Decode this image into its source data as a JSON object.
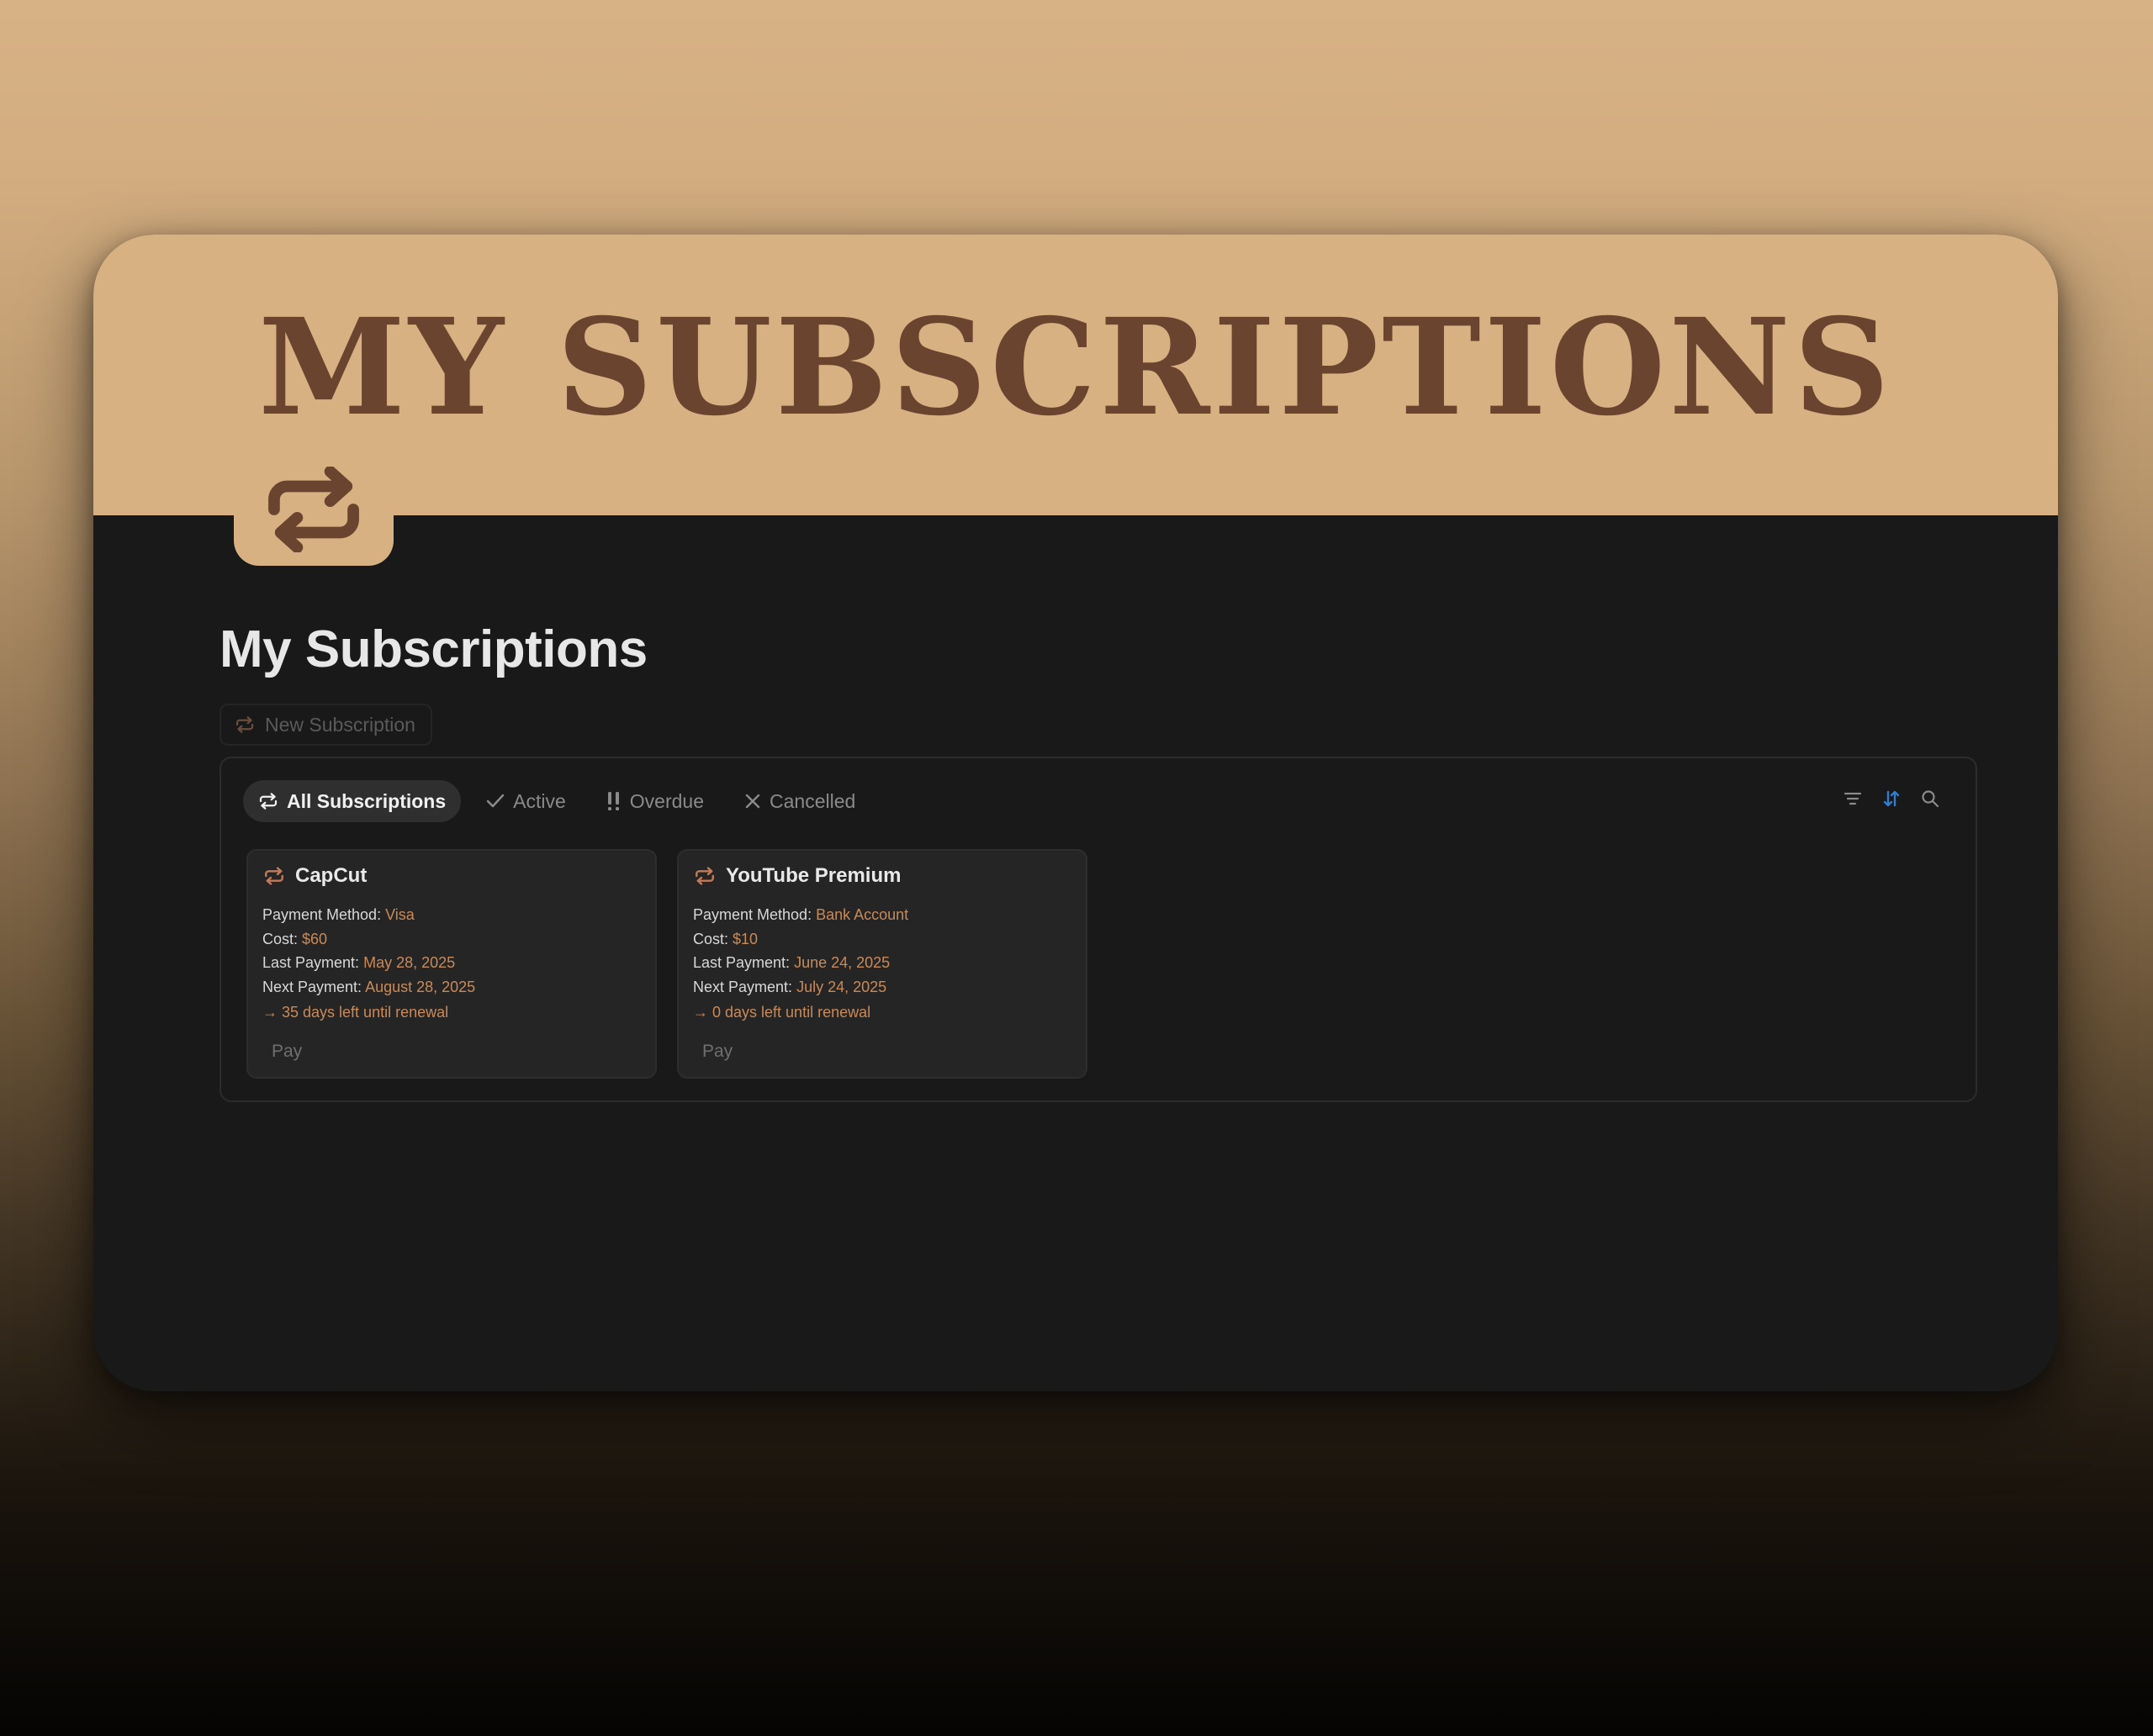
{
  "banner": {
    "title": "MY SUBSCRIPTIONS",
    "icon": "repeat-icon"
  },
  "page": {
    "title": "My Subscriptions",
    "new_button": "New Subscription"
  },
  "tabs": [
    {
      "label": "All Subscriptions",
      "icon": "repeat-icon",
      "selected": true
    },
    {
      "label": "Active",
      "icon": "check-icon",
      "selected": false
    },
    {
      "label": "Overdue",
      "icon": "double-exclamation-icon",
      "selected": false
    },
    {
      "label": "Cancelled",
      "icon": "x-icon",
      "selected": false
    }
  ],
  "toolbar": {
    "icons": [
      "filter-icon",
      "sort-icon",
      "search-icon"
    ]
  },
  "cards": [
    {
      "name": "CapCut",
      "payment_method_label": "Payment Method:",
      "payment_method": "Visa",
      "cost_label": "Cost:",
      "cost": "$60",
      "last_payment_label": "Last Payment:",
      "last_payment": "May 28, 2025",
      "next_payment_label": "Next Payment:",
      "next_payment": "August 28, 2025",
      "renewal": "→ 35 days left until renewal",
      "pay_label": "Pay"
    },
    {
      "name": "YouTube Premium",
      "payment_method_label": "Payment Method:",
      "payment_method": "Bank Account",
      "cost_label": "Cost:",
      "cost": "$10",
      "last_payment_label": "Last Payment:",
      "last_payment": "June 24, 2025",
      "next_payment_label": "Next Payment:",
      "next_payment": "July 24, 2025",
      "renewal": "→ 0 days left until renewal",
      "pay_label": "Pay"
    }
  ],
  "colors": {
    "banner_bg": "#d7b182",
    "banner_text": "#6b4430",
    "page_bg": "#191919",
    "card_bg": "#252525",
    "accent": "#c98a58",
    "sort_active": "#2f7fd1"
  }
}
